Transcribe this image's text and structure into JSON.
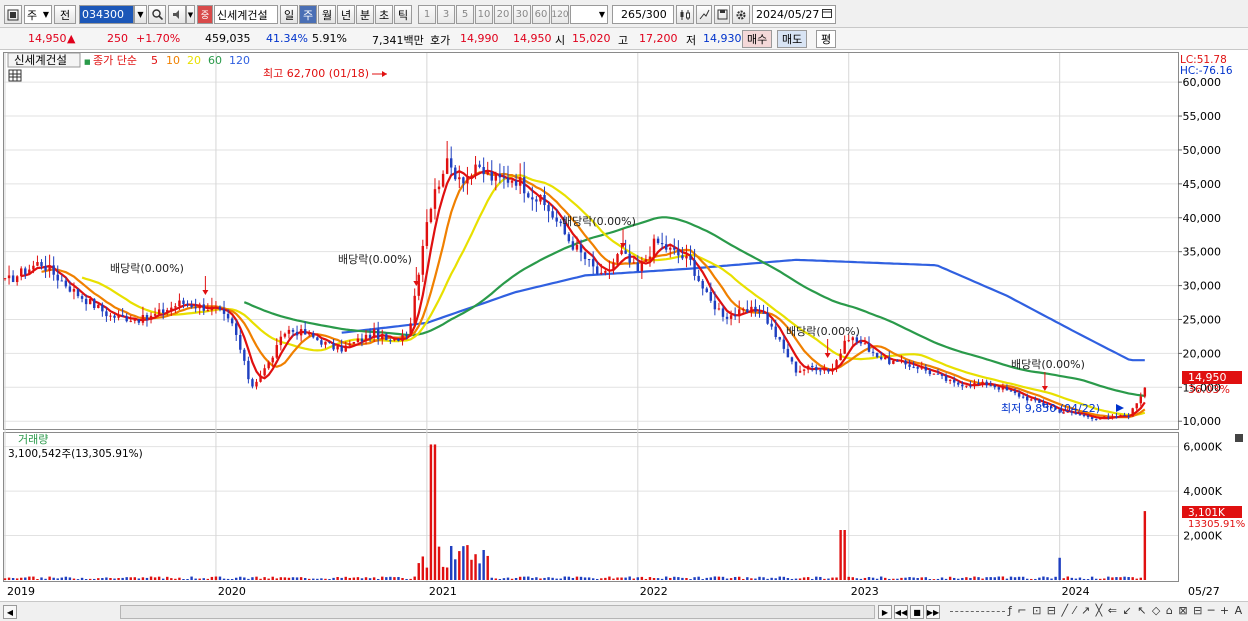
{
  "toolbar": {
    "mode_label": "주",
    "prev_label": "전",
    "stock_code": "034300",
    "stock_badge": "중",
    "stock_name": "신세계건설",
    "period_tabs": [
      "일",
      "주",
      "월",
      "년",
      "분",
      "초",
      "틱"
    ],
    "active_period": "주",
    "interval_buttons": [
      "1",
      "3",
      "5",
      "10",
      "20",
      "30",
      "60",
      "120"
    ],
    "count_value": "265",
    "count_total": "/300",
    "date_value": "2024/05/27"
  },
  "quote": {
    "price": "14,950",
    "change": "250",
    "change_pct": "+1.70%",
    "volume": "459,035",
    "turnover_ratio": "41.34%",
    "ratio2": "5.91%",
    "trade_value": "7,341백만",
    "bid_label": "호가",
    "bid1": "14,990",
    "bid2": "14,950",
    "open_label": "시",
    "open": "15,020",
    "high_label": "고",
    "high": "17,200",
    "low_label": "저",
    "low": "14,930",
    "buy_button": "매수",
    "sell_button": "매도",
    "eval_button": "평"
  },
  "legend": {
    "name": "신세계건설",
    "price_label": "종가 단순",
    "ma_periods": [
      "5",
      "10",
      "20",
      "60",
      "120"
    ],
    "ma_colors": [
      "#e01010",
      "#f08000",
      "#e8e000",
      "#2a9a4a",
      "#3060e0"
    ]
  },
  "corner": {
    "lc": "LC:51.78",
    "hc": "HC:-76.16"
  },
  "price_axis": {
    "ticks": [
      "60,000",
      "55,000",
      "50,000",
      "45,000",
      "40,000",
      "35,000",
      "30,000",
      "25,000",
      "20,000",
      "15,000",
      "10,000"
    ],
    "current_price": "14,950",
    "current_pct": "36.03%"
  },
  "annotations": {
    "high": "최고 62,700 (01/18)",
    "low": "최저 9,850 (04/22)",
    "dividends": [
      "배당락(0.00%)",
      "배당락(0.00%)",
      "배당락(0.00%)",
      "배당락(0.00%)",
      "배당락(0.00%)"
    ]
  },
  "volume_panel": {
    "title": "거래량",
    "info": "3,100,542주(13,305.91%)",
    "ticks": [
      "6,000K",
      "4,000K",
      "2,000K"
    ],
    "current": "3,101K",
    "current_pct": "13305.91%"
  },
  "x_axis": {
    "labels": [
      "2019",
      "2020",
      "2021",
      "2022",
      "2023",
      "2024"
    ],
    "last_label": "05/27"
  },
  "chart_data": {
    "type": "candlestick",
    "frequency": "weekly",
    "y_range": [
      9000,
      64000
    ],
    "volume_range_k": [
      0,
      6300
    ],
    "series_close": [
      [
        "2019-01",
        30500
      ],
      [
        "2019-03",
        33500
      ],
      [
        "2019-05",
        29000
      ],
      [
        "2019-07",
        25500
      ],
      [
        "2019-09",
        25000
      ],
      [
        "2019-11",
        27500
      ],
      [
        "2020-01",
        26500
      ],
      [
        "2020-02",
        24000
      ],
      [
        "2020-03",
        15000
      ],
      [
        "2020-04",
        18500
      ],
      [
        "2020-05",
        23500
      ],
      [
        "2020-06",
        23000
      ],
      [
        "2020-08",
        20500
      ],
      [
        "2020-10",
        23000
      ],
      [
        "2020-11",
        21500
      ],
      [
        "2020-12",
        23500
      ],
      [
        "2021-01",
        40000
      ],
      [
        "2021-02",
        48000
      ],
      [
        "2021-03",
        46000
      ],
      [
        "2021-04",
        47000
      ],
      [
        "2021-05",
        45500
      ],
      [
        "2021-06",
        46000
      ],
      [
        "2021-08",
        41000
      ],
      [
        "2021-09",
        37000
      ],
      [
        "2021-10",
        34000
      ],
      [
        "2021-11",
        31000
      ],
      [
        "2021-12",
        35000
      ],
      [
        "2022-01",
        32000
      ],
      [
        "2022-02",
        36500
      ],
      [
        "2022-03",
        35000
      ],
      [
        "2022-04",
        33500
      ],
      [
        "2022-05",
        28000
      ],
      [
        "2022-06",
        25500
      ],
      [
        "2022-08",
        26500
      ],
      [
        "2022-09",
        22000
      ],
      [
        "2022-10",
        17500
      ],
      [
        "2022-11",
        18000
      ],
      [
        "2022-12",
        17500
      ],
      [
        "2023-01",
        22500
      ],
      [
        "2023-02",
        21000
      ],
      [
        "2023-03",
        19000
      ],
      [
        "2023-05",
        18000
      ],
      [
        "2023-07",
        15500
      ],
      [
        "2023-09",
        15500
      ],
      [
        "2023-11",
        13500
      ],
      [
        "2024-01",
        11500
      ],
      [
        "2024-03",
        10500
      ],
      [
        "2024-04",
        10500
      ],
      [
        "2024-05",
        11000
      ],
      [
        "2024-05-27",
        14950
      ]
    ],
    "ma120": [
      [
        "2020-08",
        23000
      ],
      [
        "2021-01",
        24500
      ],
      [
        "2021-06",
        29000
      ],
      [
        "2021-10",
        31500
      ],
      [
        "2022-04",
        32500
      ],
      [
        "2022-10",
        33800
      ],
      [
        "2023-01",
        33500
      ],
      [
        "2023-06",
        33000
      ],
      [
        "2023-10",
        28500
      ],
      [
        "2024-02",
        23000
      ],
      [
        "2024-05",
        19000
      ]
    ]
  }
}
